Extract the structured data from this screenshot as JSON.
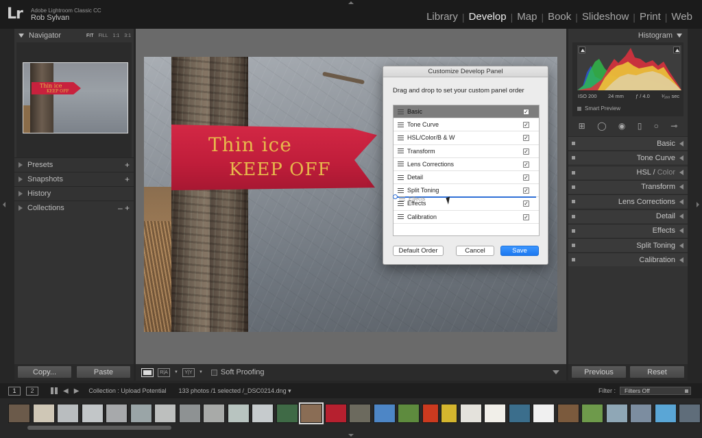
{
  "app": {
    "logo": "Lr",
    "product": "Adobe Lightroom Classic CC",
    "user": "Rob Sylvan"
  },
  "modules": [
    {
      "label": "Library",
      "active": false
    },
    {
      "label": "Develop",
      "active": true
    },
    {
      "label": "Map",
      "active": false
    },
    {
      "label": "Book",
      "active": false
    },
    {
      "label": "Slideshow",
      "active": false
    },
    {
      "label": "Print",
      "active": false
    },
    {
      "label": "Web",
      "active": false
    }
  ],
  "left_panel": {
    "navigator": {
      "title": "Navigator",
      "zoom_options": [
        "FIT",
        "FILL",
        "1:1",
        "3:1"
      ],
      "active_zoom": "FIT"
    },
    "sections": [
      {
        "label": "Presets",
        "control": "+"
      },
      {
        "label": "Snapshots",
        "control": "+"
      },
      {
        "label": "History",
        "control": ""
      },
      {
        "label": "Collections",
        "control": "– +"
      }
    ],
    "copy_label": "Copy...",
    "paste_label": "Paste"
  },
  "photo": {
    "sign_line1": "Thin ice",
    "sign_line2": "KEEP OFF"
  },
  "dialog": {
    "title": "Customize Develop Panel",
    "instruction": "Drag and drop to set your custom panel order",
    "items": [
      {
        "label": "Basic",
        "checked": true,
        "selected": true
      },
      {
        "label": "Tone Curve",
        "checked": true,
        "selected": false
      },
      {
        "label": "HSL/Color/B & W",
        "checked": true,
        "selected": false
      },
      {
        "label": "Transform",
        "checked": true,
        "selected": false
      },
      {
        "label": "Lens Corrections",
        "checked": true,
        "selected": false
      },
      {
        "label": "Detail",
        "checked": true,
        "selected": false
      },
      {
        "label": "Split Toning",
        "checked": true,
        "selected": false
      },
      {
        "label": "Effects",
        "checked": true,
        "selected": false
      },
      {
        "label": "Calibration",
        "checked": true,
        "selected": false
      }
    ],
    "drag_ghost_label": "Effects",
    "default_order_label": "Default Order",
    "cancel_label": "Cancel",
    "save_label": "Save"
  },
  "center_toolbar": {
    "soft_proofing_label": "Soft Proofing",
    "soft_proofing_checked": false
  },
  "right_panel": {
    "histogram": {
      "title": "Histogram",
      "iso": "ISO 200",
      "focal": "24 mm",
      "aperture": "ƒ / 4.0",
      "shutter": "¹⁄₁₆₀ sec",
      "smart_preview": "Smart Preview"
    },
    "sections": [
      {
        "label": "Basic",
        "dim_suffix": ""
      },
      {
        "label": "Tone Curve",
        "dim_suffix": ""
      },
      {
        "label": "HSL / ",
        "dim_suffix": "Color"
      },
      {
        "label": "Transform",
        "dim_suffix": ""
      },
      {
        "label": "Lens Corrections",
        "dim_suffix": ""
      },
      {
        "label": "Detail",
        "dim_suffix": ""
      },
      {
        "label": "Effects",
        "dim_suffix": ""
      },
      {
        "label": "Split Toning",
        "dim_suffix": ""
      },
      {
        "label": "Calibration",
        "dim_suffix": ""
      }
    ],
    "previous_label": "Previous",
    "reset_label": "Reset"
  },
  "filmstrip_bar": {
    "view1": "1",
    "view2": "2",
    "collection": "Collection : Upload Potential",
    "count": "133 photos /1 selected /_DSC0214.dng ▾",
    "filter_label": "Filter :",
    "filter_value": "Filters Off"
  },
  "filmstrip": {
    "thumb_colors": [
      "#6b5a4a",
      "#cfc7b6",
      "#b9bdbf",
      "#c2c6c8",
      "#a7a9ab",
      "#9aa5a7",
      "#bdbfbe",
      "#8e9293",
      "#a8aaa8",
      "#b8c4c0",
      "#c6cbcd",
      "#3f6a46",
      "#8a6d55",
      "#b6202f",
      "#6c6a5e",
      "#4d86c6",
      "#5e8b3e",
      "#cc3a1f",
      "#d4b52e",
      "#e4e2dc",
      "#f1efe9",
      "#3b6e8c",
      "#f0f0f0",
      "#7b5a3d",
      "#6e9a4b",
      "#8fa7b6",
      "#7c8da0",
      "#5aa6d6",
      "#5f6d7a"
    ],
    "selected_index": 12
  },
  "colors": {
    "accent": "#1c78f0",
    "sign_red": "#c8213d",
    "sign_text": "#e7b94c"
  }
}
